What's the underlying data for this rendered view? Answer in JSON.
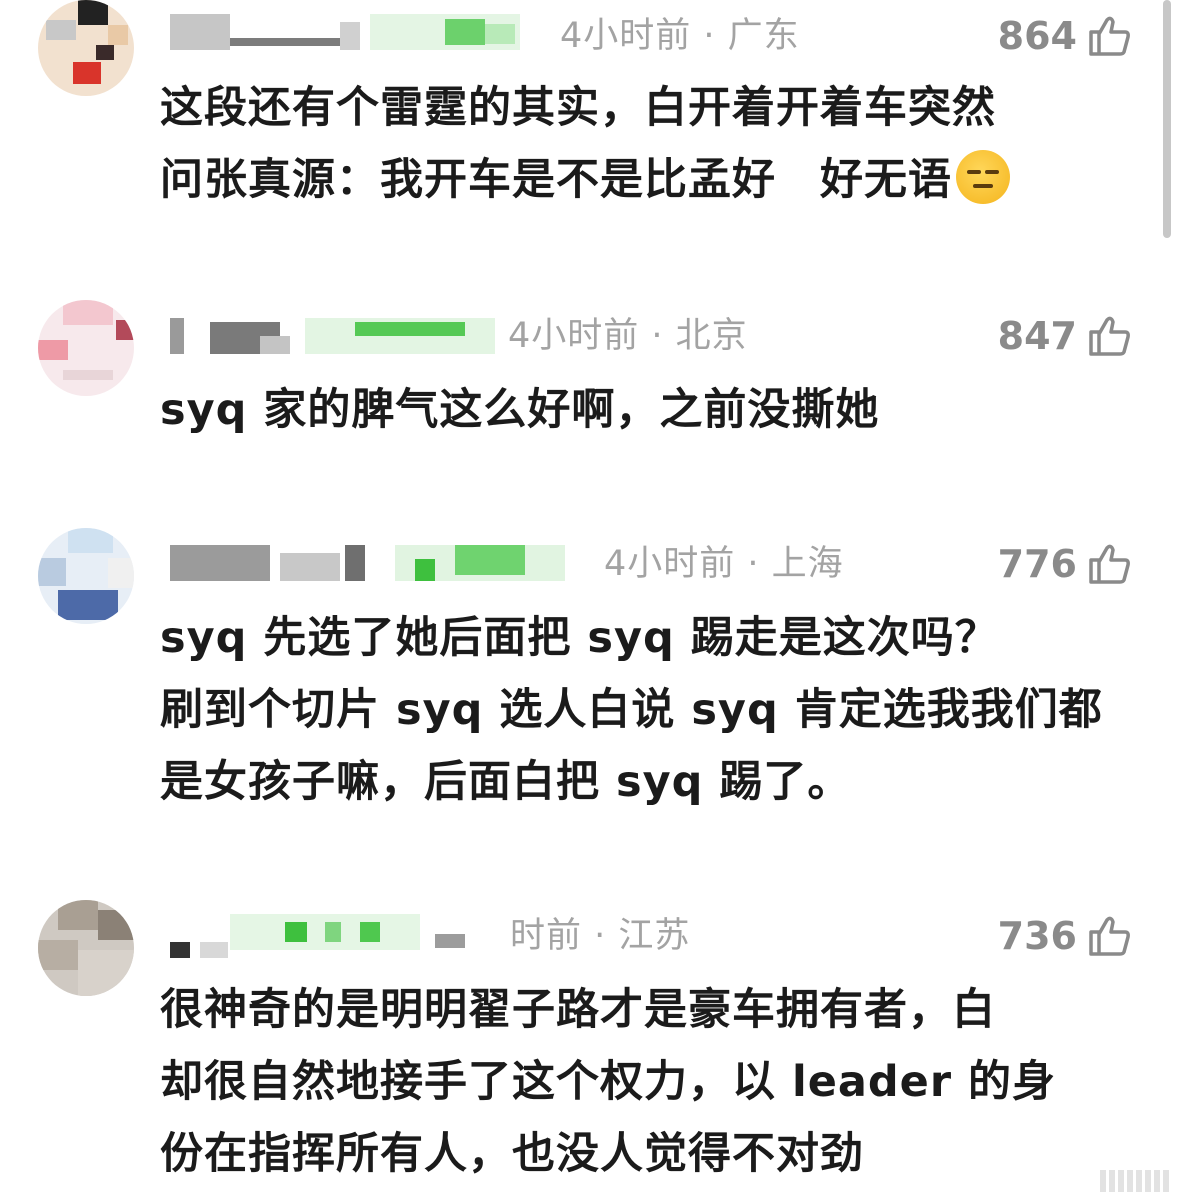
{
  "comments": [
    {
      "meta": "4小时前 · 广东",
      "likes": "864",
      "lines": [
        "这段还有个雷霆的其实，白开着开着车突然",
        "问张真源：我开车是不是比孟好　好无语"
      ]
    },
    {
      "meta": "4小时前 · 北京",
      "likes": "847",
      "lines": [
        "syq 家的脾气这么好啊，之前没撕她"
      ]
    },
    {
      "meta": "4小时前 · 上海",
      "likes": "776",
      "lines": [
        "syq 先选了她后面把 syq 踢走是这次吗？",
        "刷到个切片 syq 选人白说 syq 肯定选我我们都",
        "是女孩子嘛，后面白把 syq 踢了。"
      ]
    },
    {
      "meta": "时前 · 江苏",
      "likes": "736",
      "lines": [
        "很神奇的是明明翟子路才是豪车拥有者，白",
        "却很自然地接手了这个权力，以 leader 的身",
        "份在指挥所有人，也没人觉得不对劲"
      ]
    }
  ],
  "icons": {
    "like": "thumbs-up-icon",
    "emoji": "expressionless-face-emoji"
  }
}
